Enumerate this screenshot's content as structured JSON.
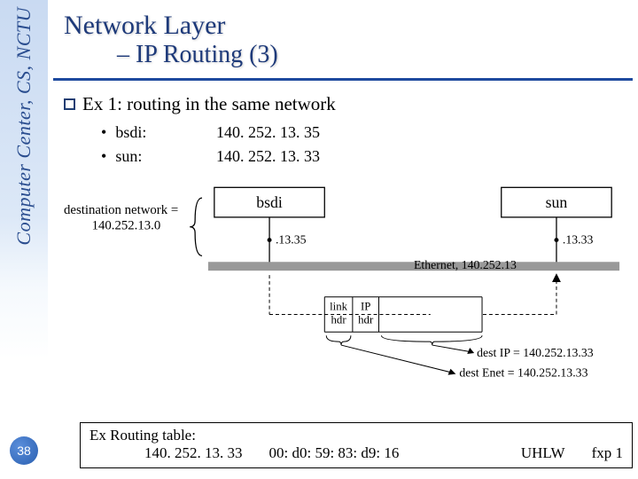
{
  "sidebar": {
    "org_text": "Computer Center, CS, NCTU",
    "page_number": "38"
  },
  "title": {
    "line1": "Network Layer",
    "line2": "– IP Routing (3)"
  },
  "section": {
    "heading": "Ex 1: routing in the same network",
    "items": [
      {
        "name": "bsdi:",
        "ip": "140. 252. 13. 35"
      },
      {
        "name": "sun:",
        "ip": "140. 252. 13. 33"
      }
    ]
  },
  "diagram": {
    "dest_network_label": "destination network =",
    "dest_network_value": "140.252.13.0",
    "host_left": "bsdi",
    "host_right": "sun",
    "iface_left": ".13.35",
    "iface_right": ".13.33",
    "ethernet_label": "Ethernet, 140.252.13",
    "link_hdr": "link\nhdr",
    "ip_hdr": "IP\nhdr",
    "dest_ip_label": "dest IP = 140.252.13.33",
    "dest_enet_label": "dest Enet = 140.252.13.33"
  },
  "footer": {
    "title": "Ex Routing table:",
    "ip": "140. 252. 13. 33",
    "mac": "00: d0: 59: 83: d9: 16",
    "flags": "UHLW",
    "iface": "fxp 1"
  }
}
